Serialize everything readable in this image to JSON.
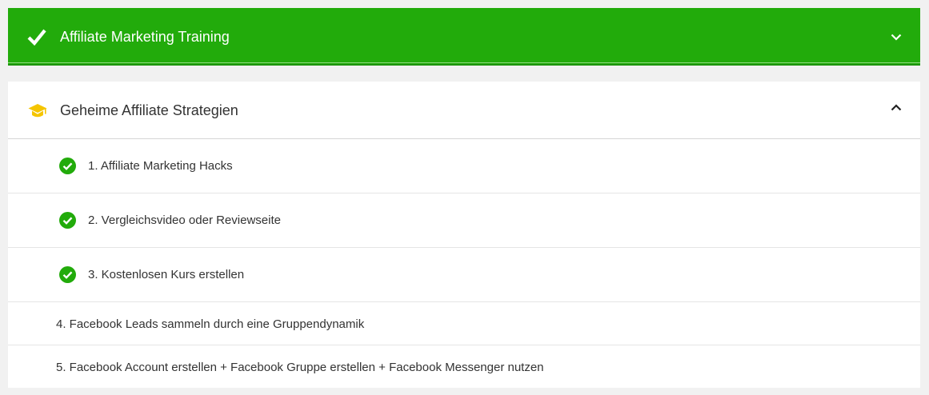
{
  "course": {
    "title": "Affiliate Marketing Training",
    "colors": {
      "header_bg": "#22ab0b",
      "check": "#ffffff"
    },
    "icons": {
      "status": "check-icon",
      "toggle": "chevron-down-icon"
    }
  },
  "module": {
    "title": "Geheime Affiliate Strategien",
    "icons": {
      "module": "graduation-cap-icon",
      "toggle": "chevron-up-icon"
    },
    "colors": {
      "cap": "#f5c500",
      "completed": "#22ab0b"
    },
    "lessons": [
      {
        "label": "1. Affiliate Marketing Hacks",
        "completed": true
      },
      {
        "label": "2. Vergleichsvideo oder Reviewseite",
        "completed": true
      },
      {
        "label": "3. Kostenlosen Kurs erstellen",
        "completed": true
      },
      {
        "label": "4. Facebook Leads sammeln durch eine Gruppendynamik",
        "completed": false
      },
      {
        "label": "5. Facebook Account erstellen + Facebook Gruppe erstellen + Facebook Messenger nutzen",
        "completed": false
      }
    ]
  }
}
